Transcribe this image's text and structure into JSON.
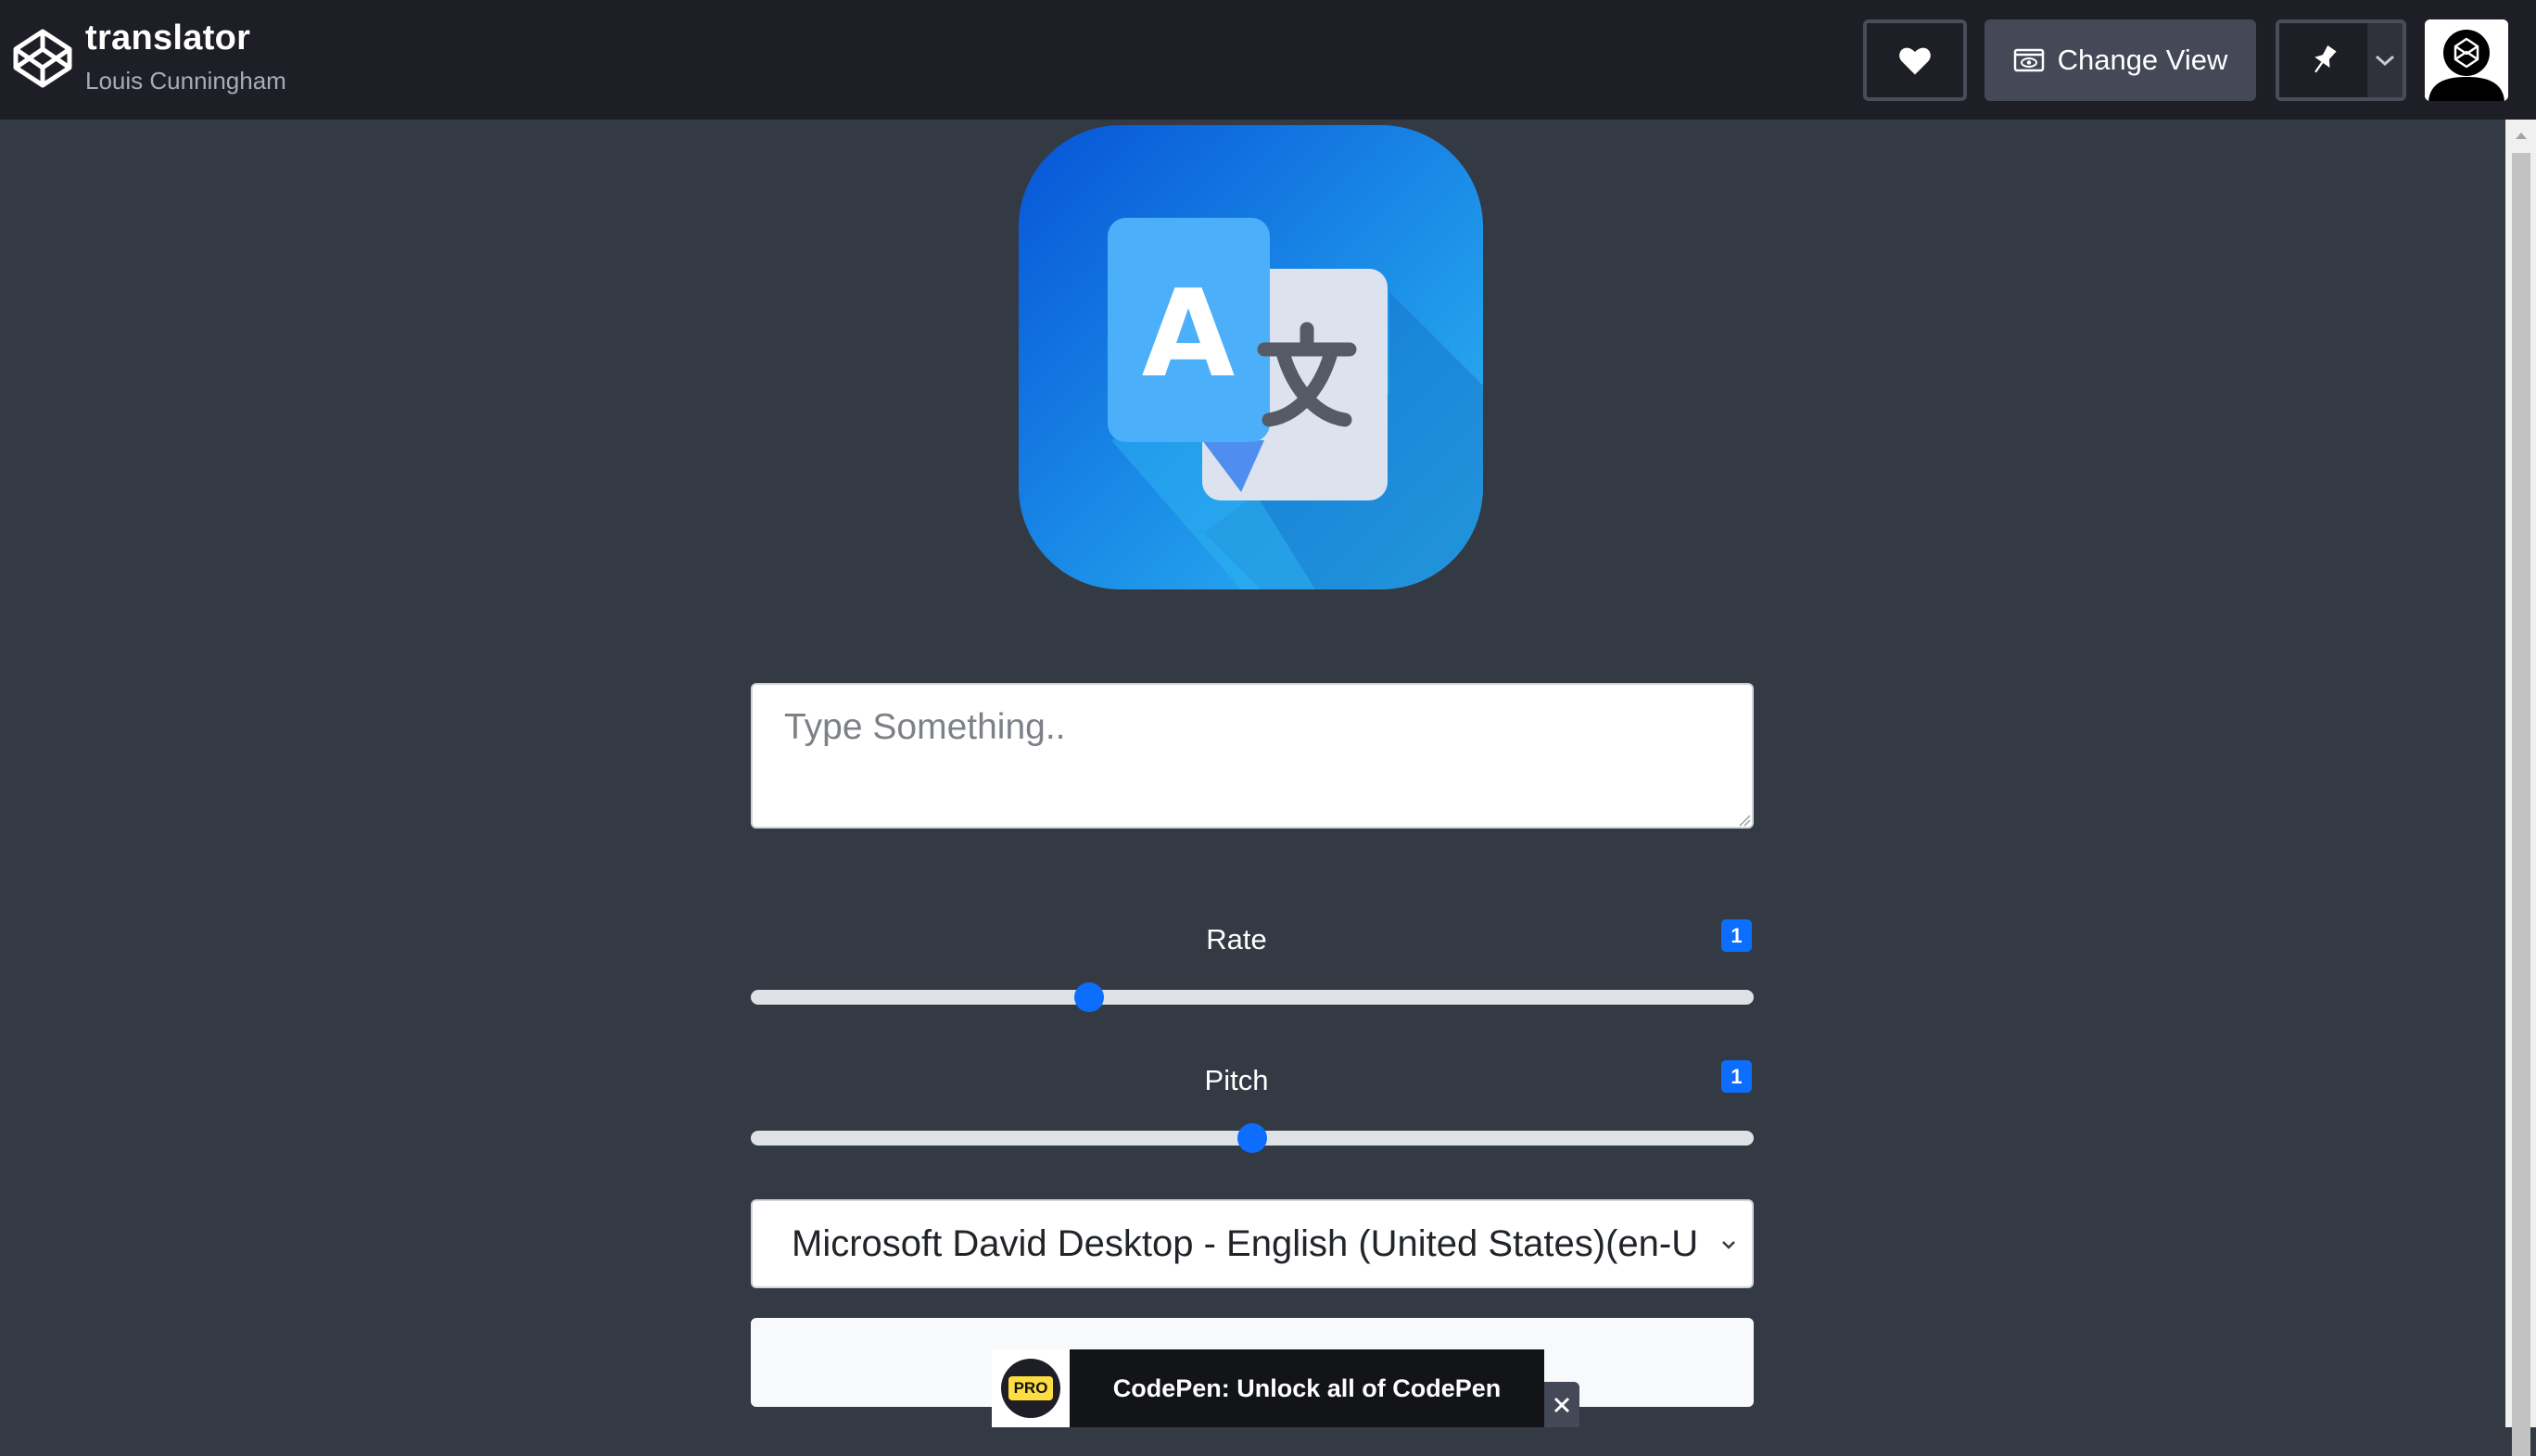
{
  "header": {
    "title": "translator",
    "author": "Louis Cunningham",
    "love_icon": "heart-icon",
    "change_view_label": "Change View",
    "change_view_icon": "eye-window-icon",
    "pin_icon": "pin-icon",
    "pin_menu_icon": "chevron-down-icon",
    "avatar_icon": "codepen-avatar"
  },
  "app": {
    "logo_icon": "translate-icon",
    "text_placeholder": "Type Something..",
    "text_value": "",
    "rate": {
      "label": "Rate",
      "value": "1",
      "slider_fraction": 0.337
    },
    "pitch": {
      "label": "Pitch",
      "value": "1",
      "slider_fraction": 0.5
    },
    "voice_selected": "Microsoft David Desktop - English (United States)(en-US)",
    "speak_label": ""
  },
  "promo": {
    "badge": "PRO",
    "text": "CodePen: Unlock all of CodePen",
    "close_icon": "close-icon"
  },
  "colors": {
    "header_bg": "#1e1f26",
    "page_bg": "#343a43",
    "accent": "#0d6efd",
    "pro_yellow": "#ffdd40"
  }
}
